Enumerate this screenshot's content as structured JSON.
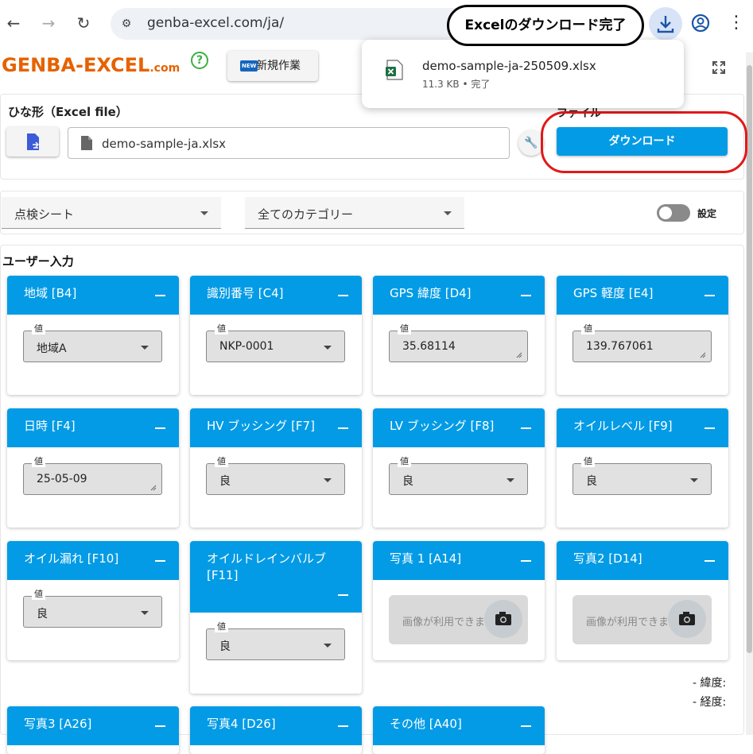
{
  "browser": {
    "url": "genba-excel.com/ja/"
  },
  "callout": {
    "text": "Excelのダウンロード完了"
  },
  "download_popup": {
    "filename": "demo-sample-ja-250509.xlsx",
    "meta": "11.3 KB • 完了"
  },
  "header": {
    "logo_main": "GENBA-EXCEL",
    "logo_suffix": ".com",
    "help": "?",
    "new_badge": "NEW",
    "new_label": "新規作業"
  },
  "template": {
    "title": "ひな形（Excel file）",
    "file_value": "demo-sample-ja.xlsx",
    "file_label": "ファイル",
    "download_label": "ダウンロード"
  },
  "filters": {
    "sheet": "点検シート",
    "category": "全てのカテゴリー",
    "settings_label": "設定"
  },
  "user_input": {
    "title": "ユーザー入力",
    "field_label": "値",
    "cards": [
      {
        "title": "地域 [B4]",
        "value": "地域A",
        "kind": "select"
      },
      {
        "title": "識別番号 [C4]",
        "value": "NKP-0001",
        "kind": "select"
      },
      {
        "title": "GPS 緯度 [D4]",
        "value": "35.68114",
        "kind": "text"
      },
      {
        "title": "GPS 軽度 [E4]",
        "value": "139.767061",
        "kind": "text"
      },
      {
        "title": "日時 [F4]",
        "value": "25-05-09",
        "kind": "text"
      },
      {
        "title": "HV ブッシング [F7]",
        "value": "良",
        "kind": "select"
      },
      {
        "title": "LV ブッシング [F8]",
        "value": "良",
        "kind": "select"
      },
      {
        "title": "オイルレベル [F9]",
        "value": "良",
        "kind": "select"
      },
      {
        "title": "オイル漏れ [F10]",
        "value": "良",
        "kind": "select"
      },
      {
        "title": "オイルドレインバルブ [F11]",
        "value": "良",
        "kind": "select"
      },
      {
        "title": "写真 1 [A14]",
        "placeholder": "画像が利用できません",
        "kind": "photo"
      },
      {
        "title": "写真2 [D14]",
        "placeholder": "画像が利用できません",
        "kind": "photo"
      },
      {
        "title": "写真3 [A26]",
        "kind": "partial"
      },
      {
        "title": "写真4 [D26]",
        "kind": "partial"
      },
      {
        "title": "その他 [A40]",
        "kind": "partial"
      }
    ],
    "lat_label": "- 緯度:",
    "lng_label": "- 経度:"
  },
  "colors": {
    "card_header": "#039be5",
    "download_button": "#039be5",
    "logo": "#e56200",
    "highlight_circle": "#e21818"
  },
  "icons": [
    "back-arrow-icon",
    "forward-arrow-icon",
    "reload-icon",
    "site-settings-icon",
    "download-icon",
    "profile-icon",
    "more-vert-icon",
    "excel-file-icon",
    "expand-icon",
    "file-swap-icon",
    "document-icon",
    "wrench-icon",
    "camera-icon",
    "minimize-icon"
  ]
}
